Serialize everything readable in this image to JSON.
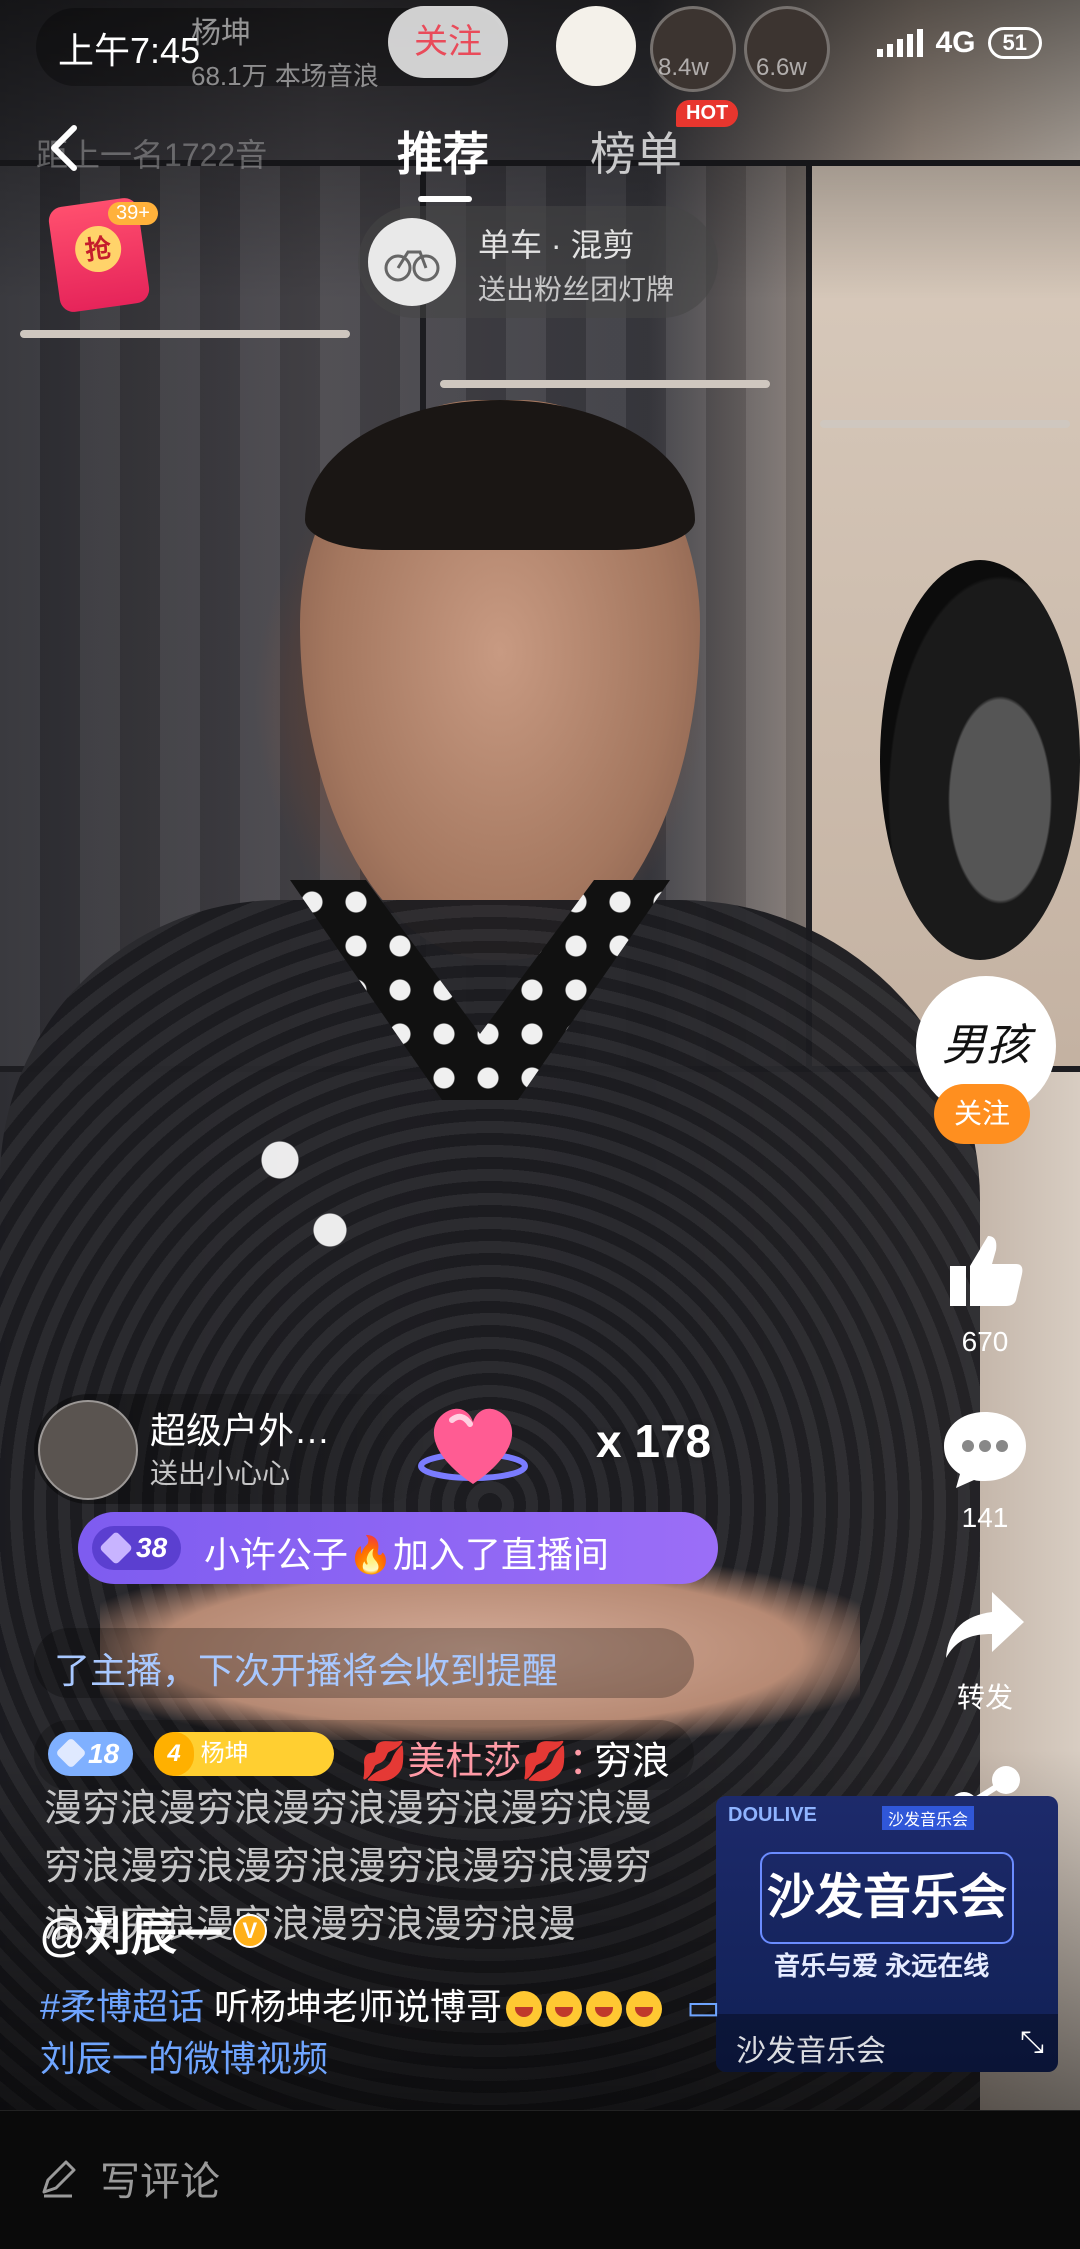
{
  "status": {
    "time": "上午7:45",
    "network": "4G",
    "battery": "51"
  },
  "live_header": {
    "host_name": "杨坤",
    "host_stats": "68.1万 本场音浪",
    "follow_label": "关注",
    "viewer_counts": [
      "8.4w",
      "6.6w"
    ],
    "rank_ghost": "距上一名1722音"
  },
  "nav": {
    "tab_recommend": "推荐",
    "tab_ranking": "榜单",
    "hot_badge": "HOT"
  },
  "red_packet": {
    "grab": "抢",
    "count": "39+"
  },
  "gift_notice": {
    "title": "单车 · 混剪",
    "subtitle": "送出粉丝团灯牌"
  },
  "right_rail": {
    "avatar_text": "男孩",
    "follow": "关注",
    "like_count": "670",
    "comment_count": "141",
    "repost": "转发",
    "share": "分享"
  },
  "chat": {
    "gift_user": "超级户外…",
    "gift_text": "送出小心心",
    "gift_multiplier": "x 178",
    "join_level": "38",
    "join_text": "小许公子🔥加入了直播间",
    "notice": "了主播，下次开播将会收到提醒",
    "danmu_level": "18",
    "fan_level": "4",
    "fan_name": "杨坤",
    "danmu_user": "💋美杜莎💋：",
    "danmu_msg": "穷浪",
    "danmu_body": "漫穷浪漫穷浪漫穷浪漫穷浪漫穷浪漫穷浪漫穷浪漫穷浪漫穷浪漫穷浪漫穷浪漫穷浪漫穷浪漫穷浪漫穷浪漫"
  },
  "promo": {
    "brand": "DOULIVE",
    "tag": "沙发音乐会",
    "title": "沙发音乐会",
    "slogan": "音乐与爱 永远在线",
    "footer": "沙发音乐会"
  },
  "caption": {
    "author": "@刘辰一",
    "topic": "#柔博超话",
    "text": "听杨坤老师说博哥",
    "link": "刘辰一的微博视频"
  },
  "bottom": {
    "comment_placeholder": "写评论"
  },
  "colors": {
    "follow_orange": "#ff8f1f",
    "hot_red": "#e8362e",
    "join_purple": "#8a63f3",
    "link_blue": "#6fa5ff"
  }
}
